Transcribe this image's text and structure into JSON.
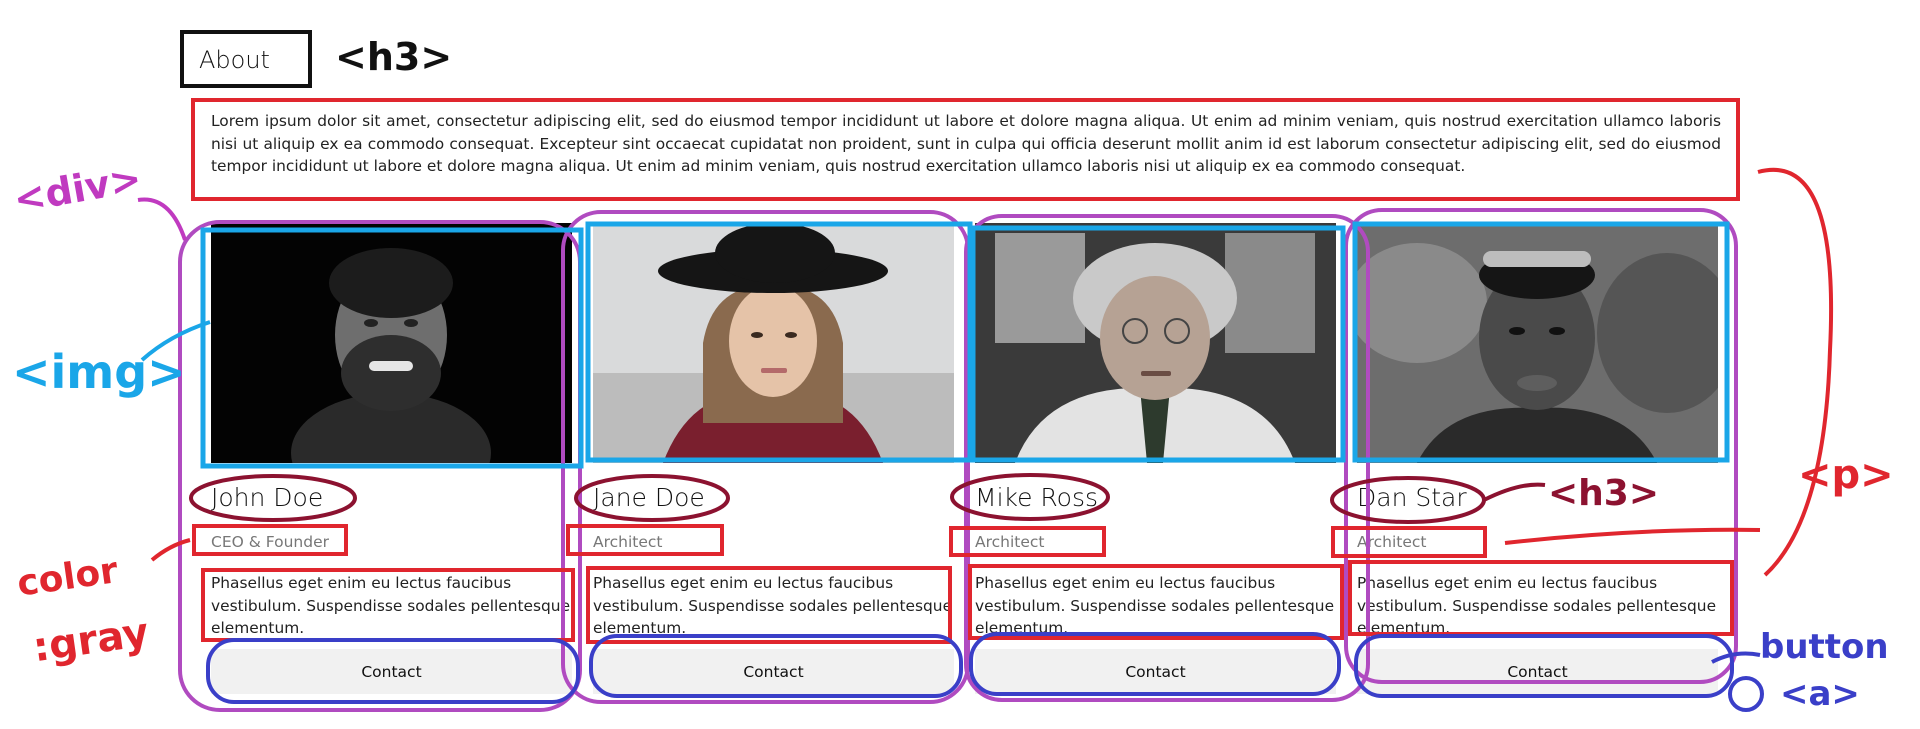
{
  "page": {
    "heading": "About",
    "intro": "Lorem ipsum dolor sit amet, consectetur adipiscing elit, sed do eiusmod tempor incididunt ut labore et dolore magna aliqua. Ut enim ad minim veniam, quis nostrud exercitation ullamco laboris nisi ut aliquip ex ea commodo consequat. Excepteur sint occaecat cupidatat non proident, sunt in culpa qui officia deserunt mollit anim id est laborum consectetur adipiscing elit, sed do eiusmod tempor incididunt ut labore et dolore magna aliqua. Ut enim ad minim veniam, quis nostrud exercitation ullamco laboris nisi ut aliquip ex ea commodo consequat."
  },
  "team": [
    {
      "name": "John Doe",
      "role": "CEO & Founder",
      "desc": "Phasellus eget enim eu lectus faucibus vestibulum. Suspendisse sodales pellentesque elementum.",
      "button": "Contact"
    },
    {
      "name": "Jane Doe",
      "role": "Architect",
      "desc": "Phasellus eget enim eu lectus faucibus vestibulum. Suspendisse sodales pellentesque elementum.",
      "button": "Contact"
    },
    {
      "name": "Mike Ross",
      "role": "Architect",
      "desc": "Phasellus eget enim eu lectus faucibus vestibulum. Suspendisse sodales pellentesque elementum.",
      "button": "Contact"
    },
    {
      "name": "Dan Star",
      "role": "Architect",
      "desc": "Phasellus eget enim eu lectus faucibus vestibulum. Suspendisse sodales pellentesque elementum.",
      "button": "Contact"
    }
  ],
  "annotations": {
    "h3_top": "<h3>",
    "div": "<div>",
    "img": "<img>",
    "color_line1": "color",
    "color_line2": ":gray",
    "h3_cards": "<h3>",
    "p": "<p>",
    "button": "button",
    "a": "<a>"
  },
  "colors": {
    "red": "#e0262e",
    "purple": "#b04bc0",
    "blue": "#1aa6e8",
    "navy": "#3a3fc8",
    "maroon": "#8c1230",
    "black": "#111111",
    "button_bg": "#f1f1f1",
    "role_gray": "#777777"
  }
}
